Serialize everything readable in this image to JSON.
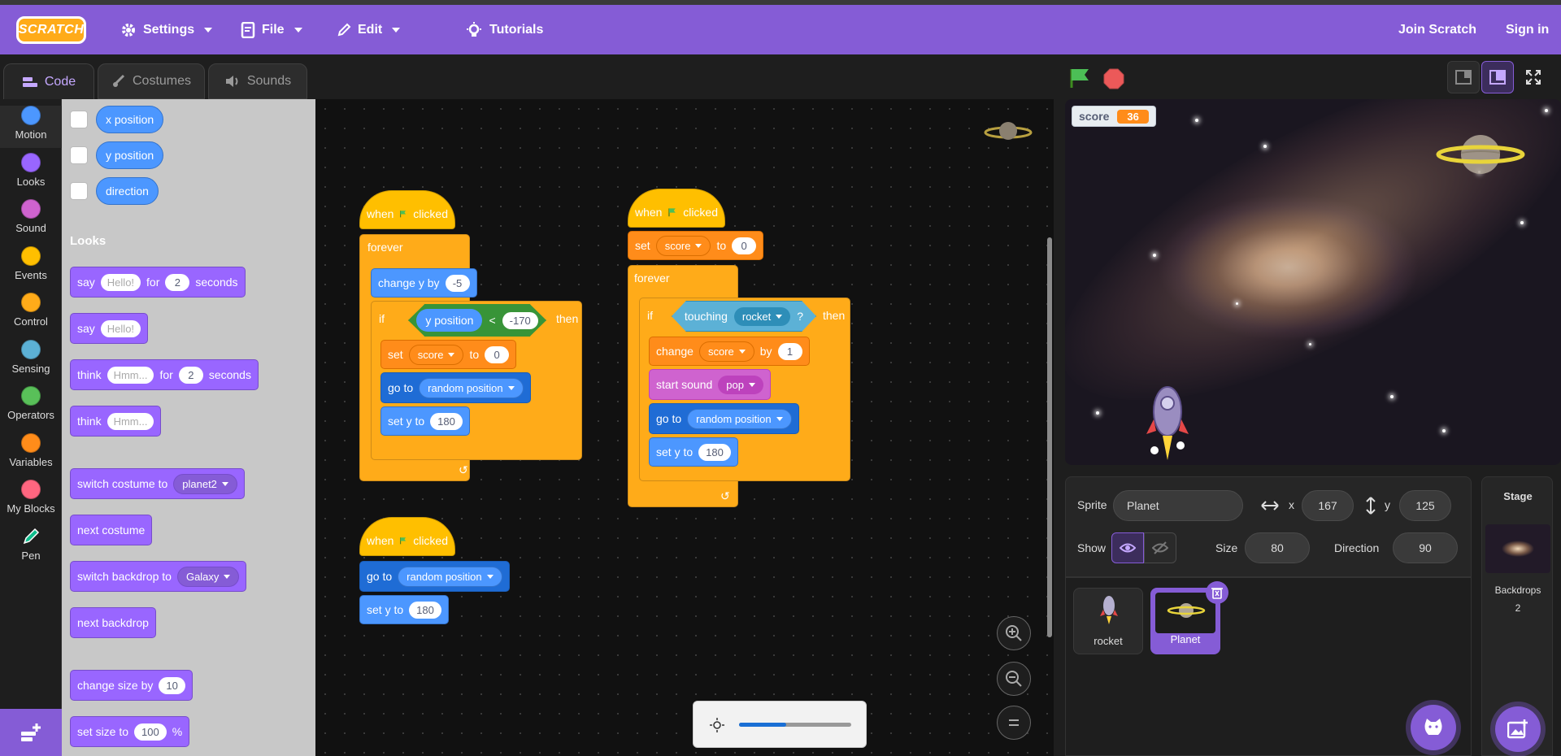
{
  "app": {
    "logo": "SCRATCH"
  },
  "menu": {
    "settings": "Settings",
    "file": "File",
    "edit": "Edit",
    "tutorials": "Tutorials",
    "join": "Join Scratch",
    "signin": "Sign in"
  },
  "tabs": {
    "code": "Code",
    "costumes": "Costumes",
    "sounds": "Sounds"
  },
  "categories": [
    {
      "label": "Motion",
      "color": "#4c97ff"
    },
    {
      "label": "Looks",
      "color": "#9966ff"
    },
    {
      "label": "Sound",
      "color": "#cf63cf"
    },
    {
      "label": "Events",
      "color": "#ffbf00"
    },
    {
      "label": "Control",
      "color": "#ffab19"
    },
    {
      "label": "Sensing",
      "color": "#5cb1d6"
    },
    {
      "label": "Operators",
      "color": "#59c059"
    },
    {
      "label": "Variables",
      "color": "#ff8c1a"
    },
    {
      "label": "My Blocks",
      "color": "#ff6680"
    },
    {
      "label": "Pen",
      "color": "#0fbd8c"
    }
  ],
  "palette": {
    "x_position": "x position",
    "y_position": "y position",
    "direction": "direction",
    "looks_heading": "Looks",
    "say": "say",
    "hello": "Hello!",
    "for": "for",
    "two": "2",
    "seconds": "seconds",
    "think": "think",
    "hmm": "Hmm...",
    "switch_costume": "switch costume to",
    "planet2": "planet2",
    "next_costume": "next costume",
    "switch_backdrop": "switch backdrop to",
    "galaxy": "Galaxy",
    "next_backdrop": "next backdrop",
    "change_size": "change size by",
    "ten": "10",
    "set_size": "set size to",
    "hundred": "100",
    "percent": "%"
  },
  "script1": {
    "when": "when",
    "clicked": "clicked",
    "forever": "forever",
    "change_y": "change y by",
    "minus5": "-5",
    "if": "if",
    "y_position": "y position",
    "lt": "<",
    "minus170": "-170",
    "then": "then",
    "set": "set",
    "score": "score",
    "to": "to",
    "zero": "0",
    "go_to": "go to",
    "random_position": "random position",
    "set_y": "set y to",
    "y180": "180"
  },
  "script2": {
    "when": "when",
    "clicked": "clicked",
    "set": "set",
    "score": "score",
    "to": "to",
    "zero": "0",
    "forever": "forever",
    "if": "if",
    "touching": "touching",
    "rocket": "rocket",
    "q": "?",
    "then": "then",
    "change": "change",
    "score2": "score",
    "by": "by",
    "one": "1",
    "start_sound": "start sound",
    "pop": "pop",
    "go_to": "go to",
    "random_position": "random position",
    "set_y": "set y to",
    "y180": "180"
  },
  "script3": {
    "when": "when",
    "clicked": "clicked",
    "go_to": "go to",
    "random_position": "random position",
    "set_y": "set y to",
    "y180": "180"
  },
  "monitor": {
    "label": "score",
    "value": "36"
  },
  "sprite_info": {
    "sprite_label": "Sprite",
    "sprite_name": "Planet",
    "x_label": "x",
    "x_value": "167",
    "y_label": "y",
    "y_value": "125",
    "show_label": "Show",
    "size_label": "Size",
    "size_value": "80",
    "direction_label": "Direction",
    "direction_value": "90"
  },
  "sprites": [
    {
      "name": "rocket"
    },
    {
      "name": "Planet"
    }
  ],
  "stage_pane": {
    "title": "Stage",
    "backdrops_label": "Backdrops",
    "backdrops_count": "2"
  },
  "brightness": {
    "level": 0.42
  }
}
